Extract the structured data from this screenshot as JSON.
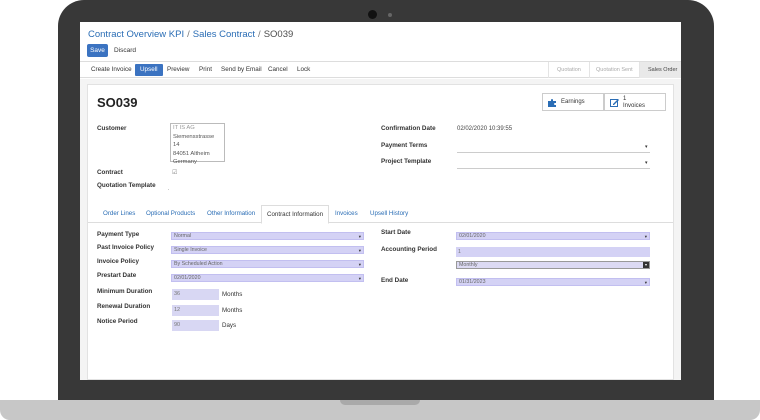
{
  "breadcrumb": {
    "item1": "Contract Overview KPI",
    "item2": "Sales Contract",
    "current": "SO039",
    "sep": "/"
  },
  "buttons": {
    "save": "Save",
    "discard": "Discard"
  },
  "actions": [
    "Create Invoice",
    "Upsell",
    "Preview",
    "Print",
    "Send by Email",
    "Cancel",
    "Lock"
  ],
  "stages": {
    "quotation": "Quotation",
    "sent": "Quotation Sent",
    "order": "Sales Order"
  },
  "record": {
    "title": "SO039"
  },
  "smart_buttons": {
    "earnings": "Earnings",
    "invoices_count": "1",
    "invoices_label": "Invoices"
  },
  "labels": {
    "customer": "Customer",
    "contract": "Contract",
    "quotation_template": "Quotation Template",
    "confirmation_date": "Confirmation Date",
    "payment_terms": "Payment Terms",
    "project_template": "Project Template"
  },
  "customer_address": [
    "IT IS AG",
    "Siemensstrasse 14",
    "84051 Altheim",
    "Germany"
  ],
  "confirmation_date": "02/02/2020 10:39:55",
  "contract_check": "☑",
  "tabs": [
    "Order Lines",
    "Optional Products",
    "Other Information",
    "Contract Information",
    "Invoices",
    "Upsell History"
  ],
  "contract_info": {
    "payment_type_label": "Payment Type",
    "payment_type": "Normal",
    "past_invoice_policy_label": "Past Invoice Policy",
    "past_invoice_policy": "Single Invoice",
    "invoice_policy_label": "Invoice Policy",
    "invoice_policy": "By Scheduled Action",
    "prestart_date_label": "Prestart Date",
    "prestart_date": "02/01/2020",
    "min_duration_label": "Minimum Duration",
    "min_duration": "36",
    "min_unit": "Months",
    "renewal_duration_label": "Renewal Duration",
    "renewal_duration": "12",
    "renewal_unit": "Months",
    "notice_period_label": "Notice Period",
    "notice_period": "90",
    "notice_unit": "Days",
    "start_date_label": "Start Date",
    "start_date": "02/01/2020",
    "accounting_period_label": "Accounting Period",
    "accounting_period": "1",
    "accounting_unit": "Monthly",
    "end_date_label": "End Date",
    "end_date": "01/31/2023"
  },
  "colors": {
    "primary": "#3b73c1",
    "link": "#2a6db5",
    "field_bg": "#d4d2f5",
    "frame": "#383838"
  }
}
